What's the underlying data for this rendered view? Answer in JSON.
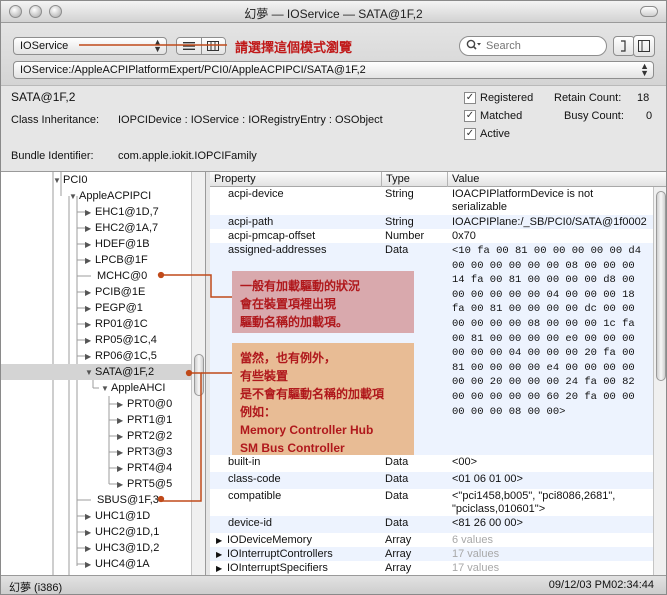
{
  "window": {
    "title": "幻夢 — IOService — SATA@1F,2"
  },
  "toolbar": {
    "plane_value": "IOService",
    "plane_annotation": "請選擇這個模式瀏覽",
    "search_placeholder": "Search",
    "path_value": "IOService:/AppleACPIPlatformExpert/PCI0/AppleACPIPCI/SATA@1F,2"
  },
  "info": {
    "name": "SATA@1F,2",
    "class_label": "Class Inheritance:",
    "class_value": "IOPCIDevice : IOService : IORegistryEntry : OSObject",
    "bundle_label": "Bundle Identifier:",
    "bundle_value": "com.apple.iokit.IOPCIFamily",
    "checks": [
      {
        "label": "Registered",
        "checked": "✓"
      },
      {
        "label": "Matched",
        "checked": "✓"
      },
      {
        "label": "Active",
        "checked": "✓"
      }
    ],
    "retain_label": "Retain Count:",
    "retain_value": "18",
    "busy_label": "Busy Count:",
    "busy_value": "0"
  },
  "tree": {
    "items": [
      {
        "label": "PCI0",
        "tri": "▼"
      },
      {
        "label": "AppleACPIPCI",
        "tri": "▼"
      },
      {
        "label": "EHC1@1D,7",
        "tri": "▶"
      },
      {
        "label": "EHC2@1A,7",
        "tri": "▶"
      },
      {
        "label": "HDEF@1B",
        "tri": "▶"
      },
      {
        "label": "LPCB@1F",
        "tri": "▶"
      },
      {
        "label": "MCHC@0",
        "tri": ""
      },
      {
        "label": "PCIB@1E",
        "tri": "▶"
      },
      {
        "label": "PEGP@1",
        "tri": "▶"
      },
      {
        "label": "RP01@1C",
        "tri": "▶"
      },
      {
        "label": "RP05@1C,4",
        "tri": "▶"
      },
      {
        "label": "RP06@1C,5",
        "tri": "▶"
      },
      {
        "label": "SATA@1F,2",
        "tri": "▼"
      },
      {
        "label": "AppleAHCI",
        "tri": "▼"
      },
      {
        "label": "PRT0@0",
        "tri": "▶"
      },
      {
        "label": "PRT1@1",
        "tri": "▶"
      },
      {
        "label": "PRT2@2",
        "tri": "▶"
      },
      {
        "label": "PRT3@3",
        "tri": "▶"
      },
      {
        "label": "PRT4@4",
        "tri": "▶"
      },
      {
        "label": "PRT5@5",
        "tri": "▶"
      },
      {
        "label": "SBUS@1F,3",
        "tri": ""
      },
      {
        "label": "UHC1@1D",
        "tri": "▶"
      },
      {
        "label": "UHC2@1D,1",
        "tri": "▶"
      },
      {
        "label": "UHC3@1D,2",
        "tri": "▶"
      },
      {
        "label": "UHC4@1A",
        "tri": "▶"
      }
    ]
  },
  "table": {
    "headers": {
      "property": "Property",
      "type": "Type",
      "value": "Value"
    },
    "rows": [
      {
        "property": "acpi-device",
        "type": "String",
        "value": "IOACPIPlatformDevice is not serializable",
        "tri": ""
      },
      {
        "property": "acpi-path",
        "type": "String",
        "value": "IOACPIPlane:/_SB/PCI0/SATA@1f0002",
        "tri": ""
      },
      {
        "property": "acpi-pmcap-offset",
        "type": "Number",
        "value": "0x70",
        "tri": ""
      },
      {
        "property": "assigned-addresses",
        "type": "Data",
        "value": "<10 fa 00 81 00 00 00 00 00 d4 00 00 00 00 00 00 08 00 00 00 14 fa 00 81 00 00 00 00 d8 00 00 00 00 00 00 04 00 00 00 18 fa 00 81 00 00 00 00 dc 00 00 00 00 00 00 08 00 00 00 1c fa 00 81 00 00 00 00 e0 00 00 00 00 00 00 04 00 00 00 20 fa 00 81 00 00 00 00 e4 00 00 00 00 00 00 20 00 00 00 24 fa 00 82 00 00 00 00 00 60 20 fa 00 00 00 00 00 08 00 00>",
        "tri": ""
      },
      {
        "property": "built-in",
        "type": "Data",
        "value": "<00>",
        "tri": ""
      },
      {
        "property": "class-code",
        "type": "Data",
        "value": "<01 06 01 00>",
        "tri": ""
      },
      {
        "property": "compatible",
        "type": "Data",
        "value": "<\"pci1458,b005\", \"pci8086,2681\", \"pciclass,010601\">",
        "tri": ""
      },
      {
        "property": "device-id",
        "type": "Data",
        "value": "<81 26 00 00>",
        "tri": ""
      },
      {
        "property": "IODeviceMemory",
        "type": "Array",
        "value": "6 values",
        "tri": "▶"
      },
      {
        "property": "IOInterruptControllers",
        "type": "Array",
        "value": "17 values",
        "tri": "▶"
      },
      {
        "property": "IOInterruptSpecifiers",
        "type": "Array",
        "value": "17 values",
        "tri": "▶"
      }
    ]
  },
  "callouts": {
    "first": [
      "一般有加載驅動的狀況",
      "會在裝置項裡出現",
      "驅動名稱的加載項。"
    ],
    "second": [
      "當然，也有例外，",
      "有些裝置",
      "是不會有驅動名稱的加載項",
      "例如：",
      "Memory Controller Hub",
      "SM Bus Controller"
    ]
  },
  "status": {
    "left": "幻夢 (i386)",
    "right": "09/12/03 PM02:34:44"
  },
  "colors": {
    "annotation_red": "#c01818",
    "callout_fill_1": "#d9a9ad",
    "callout_fill_2": "#e8bc95",
    "selection": "#d4d4d4"
  }
}
